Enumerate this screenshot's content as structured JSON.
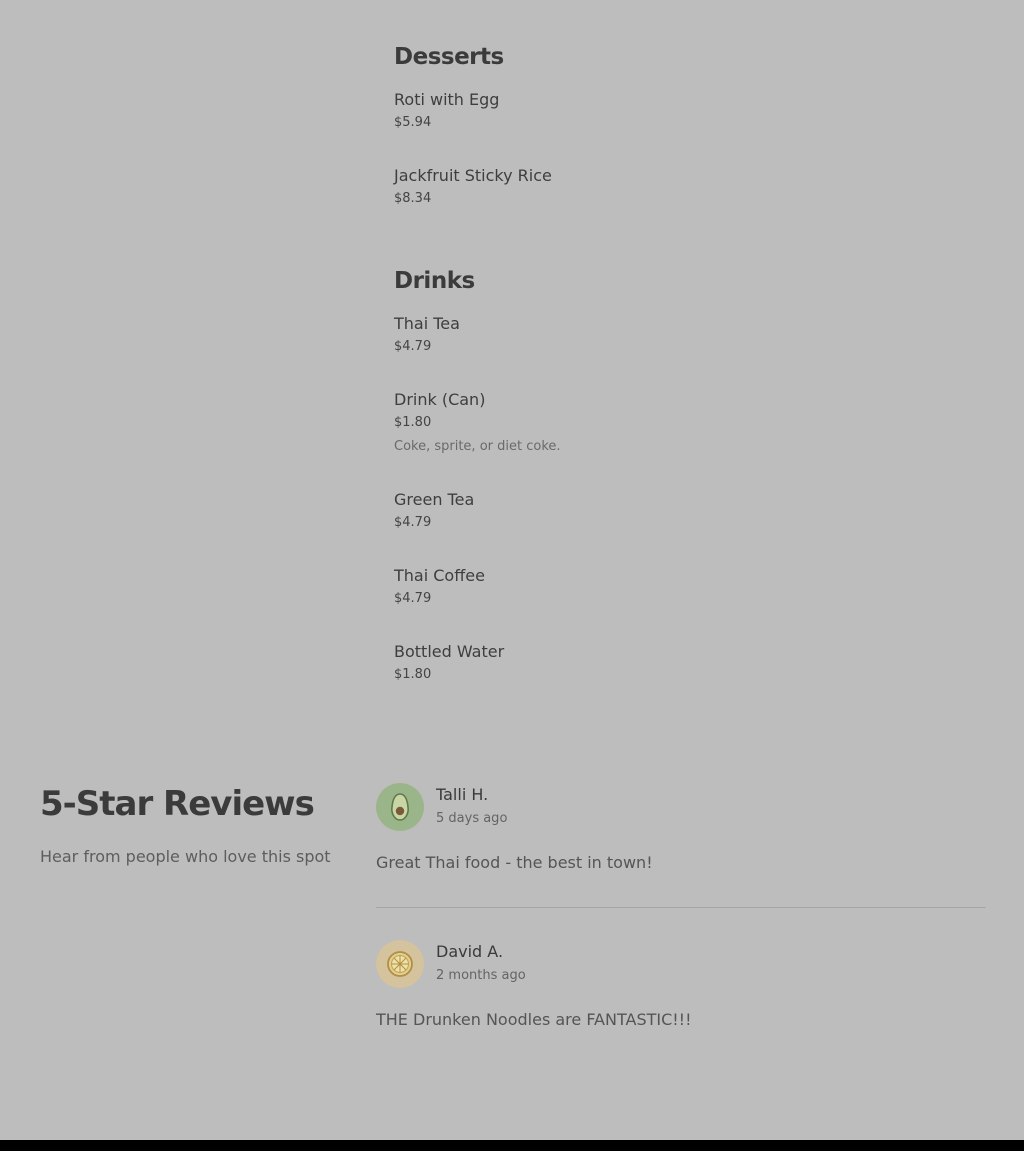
{
  "menu": {
    "sections": [
      {
        "title": "Desserts",
        "items": [
          {
            "name": "Roti with Egg",
            "price": "$5.94"
          },
          {
            "name": "Jackfruit Sticky Rice",
            "price": "$8.34"
          }
        ]
      },
      {
        "title": "Drinks",
        "items": [
          {
            "name": "Thai Tea",
            "price": "$4.79"
          },
          {
            "name": "Drink (Can)",
            "price": "$1.80",
            "description": "Coke, sprite, or diet coke."
          },
          {
            "name": "Green Tea",
            "price": "$4.79"
          },
          {
            "name": "Thai Coffee",
            "price": "$4.79"
          },
          {
            "name": "Bottled Water",
            "price": "$1.80"
          }
        ]
      }
    ]
  },
  "reviews": {
    "title": "5-Star Reviews",
    "subtitle": "Hear from people who love this spot",
    "items": [
      {
        "name": "Talli H.",
        "date": "5 days ago",
        "text": "Great Thai food - the best in town!",
        "avatar_icon": "avocado-icon",
        "avatar_color": "#9bb58a"
      },
      {
        "name": "David A.",
        "date": "2 months ago",
        "text": "THE Drunken Noodles are FANTASTIC!!!",
        "avatar_icon": "lemon-slice-icon",
        "avatar_color": "#d4c39d"
      }
    ]
  },
  "colors": {
    "background": "#bdbdbd",
    "footer": "#000000"
  }
}
